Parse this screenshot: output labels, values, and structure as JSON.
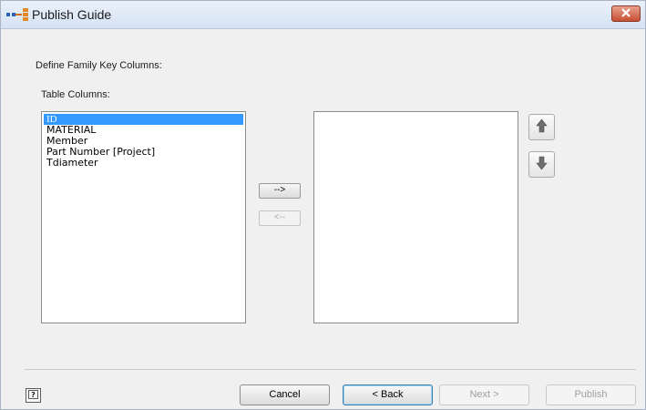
{
  "window": {
    "title": "Publish Guide"
  },
  "page": {
    "heading": "Define Family Key Columns:",
    "table_columns_label": "Table Columns:"
  },
  "table_columns": [
    {
      "label": "ID",
      "selected": true
    },
    {
      "label": "MATERIAL",
      "selected": false
    },
    {
      "label": "Member",
      "selected": false
    },
    {
      "label": "Part Number [Project]",
      "selected": false
    },
    {
      "label": "Tdiameter",
      "selected": false
    }
  ],
  "key_columns": [],
  "move_buttons": {
    "add_label": "-->",
    "remove_label": "<--"
  },
  "footer": {
    "cancel_label": "Cancel",
    "back_label": "< Back",
    "next_label": "Next >",
    "publish_label": "Publish"
  },
  "icons": {
    "app": "publish-guide-app-icon",
    "close": "close-icon",
    "move_up": "arrow-up-icon",
    "move_down": "arrow-down-icon",
    "help": "help-icon"
  },
  "colors": {
    "selection": "#3399ff",
    "close_button": "#c74f33"
  }
}
